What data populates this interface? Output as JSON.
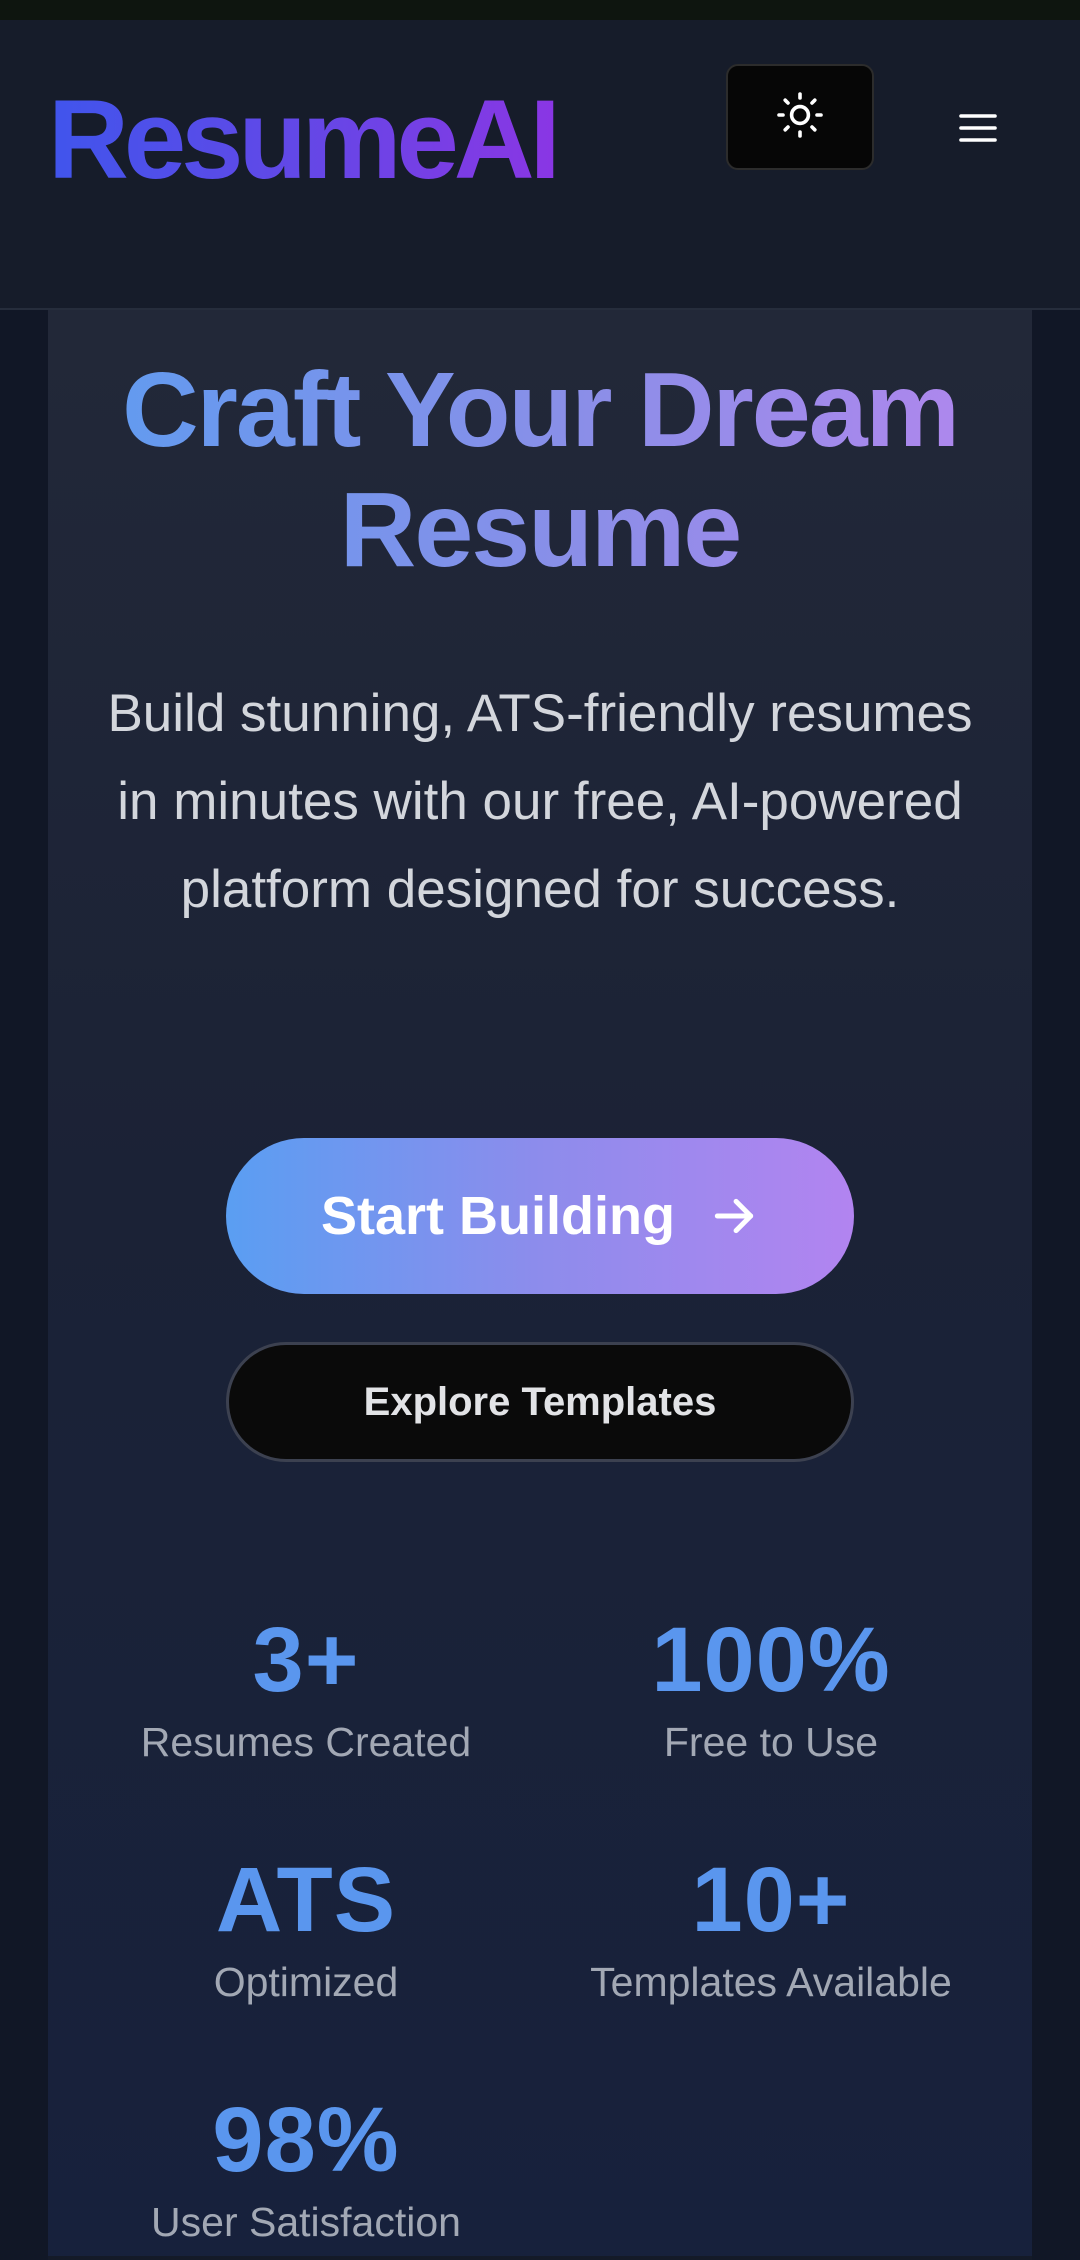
{
  "header": {
    "logo": "ResumeAI",
    "theme_toggle_icon": "sun-icon",
    "menu_icon": "hamburger-menu-icon"
  },
  "hero": {
    "title_line1": "Craft Your Dream",
    "title_line2": "Resume",
    "subtitle": "Build stunning, ATS-friendly resumes in minutes with our free, AI-powered platform designed for success.",
    "primary_button": "Start Building",
    "primary_button_icon": "arrow-right-icon",
    "secondary_button": "Explore Templates"
  },
  "stats": [
    {
      "value": "3+",
      "label": "Resumes Created"
    },
    {
      "value": "100%",
      "label": "Free to Use"
    },
    {
      "value": "ATS",
      "label": "Optimized"
    },
    {
      "value": "10+",
      "label": "Templates Available"
    },
    {
      "value": "98%",
      "label": "User Satisfaction"
    }
  ],
  "colors": {
    "accent_blue": "#5a96ee",
    "accent_purple": "#b284f0",
    "background": "#141a28"
  }
}
